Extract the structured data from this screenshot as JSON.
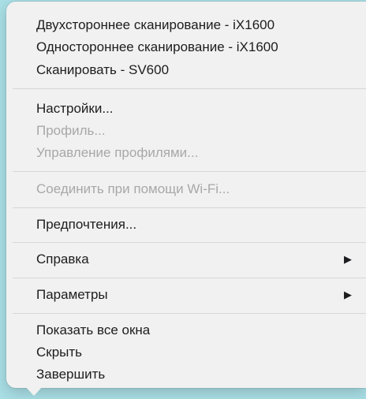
{
  "menu": {
    "scan_group": [
      "Двухстороннее сканирование - iX1600",
      "Одностороннее сканирование - iX1600",
      "Сканировать - SV600"
    ],
    "settings": "Настройки...",
    "profile": "Профиль...",
    "profile_management": "Управление профилями...",
    "wifi_connect": "Соединить при помощи Wi-Fi...",
    "preferences": "Предпочтения...",
    "help": "Справка",
    "options": "Параметры",
    "submenu_arrow": "▶",
    "show_all_windows": "Показать все окна",
    "hide": "Скрыть",
    "quit": "Завершить"
  }
}
